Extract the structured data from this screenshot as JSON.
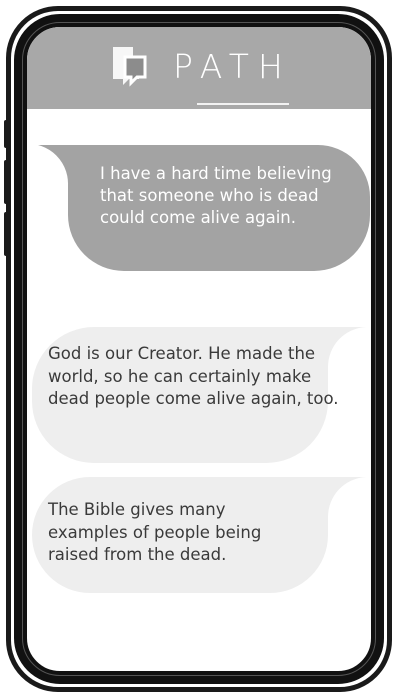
{
  "app": {
    "logo_text": "PATH"
  },
  "messages": [
    {
      "text": "I have a hard time believing that someone who is dead could come alive again.",
      "style": "dark",
      "color": "#a3a3a3",
      "text_color": "#ffffff"
    },
    {
      "text": "God is our Creator. He made the world, so he can certainly make dead people come alive again, too.",
      "style": "light",
      "color": "#eeeeee",
      "text_color": "#3a3a3a"
    },
    {
      "text": "The Bible gives many examples of people being raised from the dead.",
      "style": "light",
      "color": "#eeeeee",
      "text_color": "#3a3a3a"
    }
  ],
  "colors": {
    "header_bg": "#a8a8a8",
    "frame": "#111111"
  }
}
